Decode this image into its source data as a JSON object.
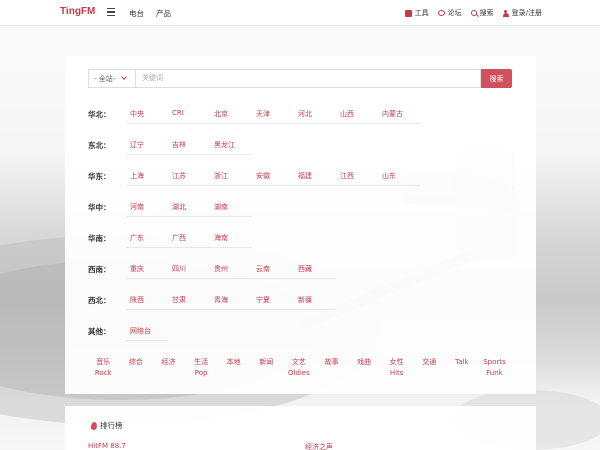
{
  "navbar": {
    "brand": "TingFM",
    "left_links": [
      "电台",
      "产品"
    ],
    "right_links": [
      {
        "label": "工具",
        "icon": "toolbox-icon"
      },
      {
        "label": "论坛",
        "icon": "chat-icon"
      },
      {
        "label": "搜索",
        "icon": "search-icon"
      },
      {
        "label": "登录/注册",
        "icon": "user-icon"
      }
    ]
  },
  "search": {
    "scope": "- 全站-",
    "placeholder": "关键词",
    "button": "搜索"
  },
  "regions": [
    {
      "label": "华北：",
      "cities": [
        "中央",
        "CRI",
        "北京",
        "天津",
        "河北",
        "山西",
        "内蒙古"
      ]
    },
    {
      "label": "东北：",
      "cities": [
        "辽宁",
        "吉林",
        "黑龙江"
      ]
    },
    {
      "label": "华东：",
      "cities": [
        "上海",
        "江苏",
        "浙江",
        "安徽",
        "福建",
        "江西",
        "山东"
      ]
    },
    {
      "label": "华中：",
      "cities": [
        "河南",
        "湖北",
        "湖南"
      ]
    },
    {
      "label": "华南：",
      "cities": [
        "广东",
        "广西",
        "海南"
      ]
    },
    {
      "label": "西南：",
      "cities": [
        "重庆",
        "四川",
        "贵州",
        "云南",
        "西藏"
      ]
    },
    {
      "label": "西北：",
      "cities": [
        "陕西",
        "甘肃",
        "青海",
        "宁夏",
        "新疆"
      ]
    },
    {
      "label": "其他：",
      "cities": [
        "网络台"
      ]
    }
  ],
  "genres": [
    [
      "音乐",
      "Rock"
    ],
    [
      "综合",
      ""
    ],
    [
      "经济",
      ""
    ],
    [
      "生活",
      "Pop"
    ],
    [
      "本地",
      ""
    ],
    [
      "新闻",
      ""
    ],
    [
      "文艺",
      "Oldies"
    ],
    [
      "故事",
      ""
    ],
    [
      "戏曲",
      ""
    ],
    [
      "女性",
      "Hits"
    ],
    [
      "交通",
      ""
    ],
    [
      "Talk",
      ""
    ],
    [
      "Sports",
      "Funk"
    ]
  ],
  "ranking": {
    "title": "排行榜",
    "items": [
      "HitFM 88.7",
      "经济之声"
    ]
  },
  "colors": {
    "accent": "#c23b4a",
    "button": "#d24f5c"
  }
}
